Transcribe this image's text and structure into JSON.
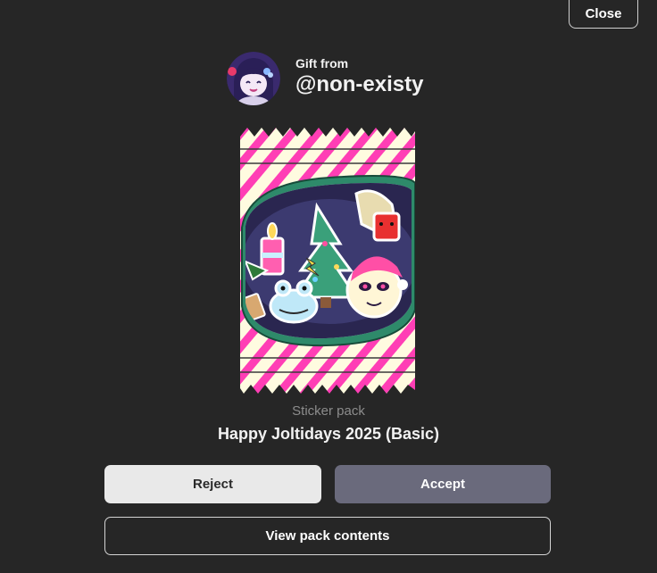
{
  "header": {
    "close_label": "Close"
  },
  "sender": {
    "gift_from_label": "Gift from",
    "username": "@non-existy",
    "avatar_icon": "avatar-icon"
  },
  "pack": {
    "type_label": "Sticker pack",
    "title": "Happy Joltidays 2025 (Basic)",
    "image_icon": "sticker-pack-wrapper-icon"
  },
  "actions": {
    "reject_label": "Reject",
    "accept_label": "Accept",
    "view_contents_label": "View pack contents"
  },
  "colors": {
    "background": "#262626",
    "reject_bg": "#e9e9e9",
    "accept_bg": "#6a6a7c",
    "pack_stripe": "#ff3eb5",
    "pack_cream": "#fffbe0",
    "pack_green": "#2e8a6a"
  }
}
